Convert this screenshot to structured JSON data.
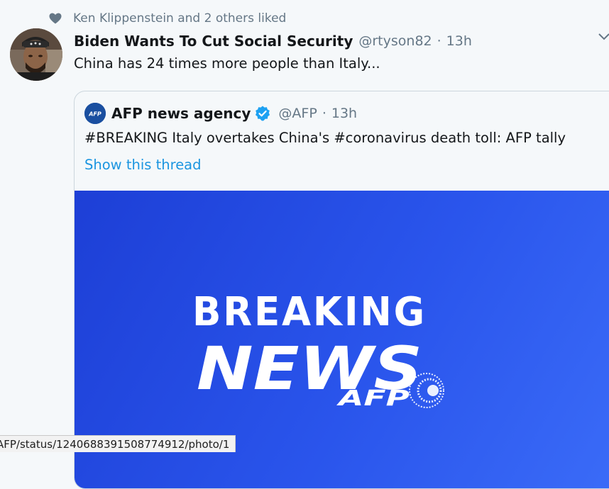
{
  "social_context": {
    "text": "Ken Klippenstein and 2 others liked"
  },
  "tweet": {
    "author_name": "Biden Wants To Cut Social Security",
    "handle": "@rtyson82",
    "separator": "·",
    "time": "13h",
    "text": "China has 24 times more people than Italy..."
  },
  "quoted_tweet": {
    "author_name": "AFP news agency",
    "handle": "@AFP",
    "separator": "·",
    "time": "13h",
    "text": "#BREAKING Italy overtakes China's #coronavirus death toll: AFP tally",
    "show_thread": "Show this thread",
    "media": {
      "line1": "BREAKING",
      "line2": "NEWS",
      "logo_text": "AFP",
      "logo_small": "AFP"
    }
  },
  "status_bar": {
    "url": "AFP/status/1240688391508774912/photo/1"
  },
  "colors": {
    "link": "#1b95e0",
    "secondary_text": "#657786",
    "media_blue": "#2a55ec",
    "verified": "#1da1f2"
  }
}
